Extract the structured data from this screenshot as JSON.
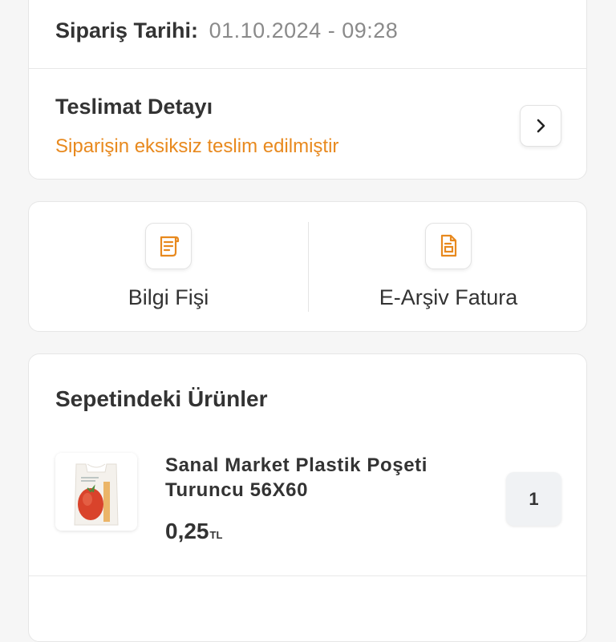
{
  "order": {
    "date_label": "Sipariş Tarihi:",
    "date_value": "01.10.2024 - 09:28"
  },
  "delivery": {
    "title": "Teslimat Detayı",
    "status": "Siparişin eksiksiz teslim edilmiştir",
    "status_color": "#e8891e",
    "action_icon": "chevron-right-icon"
  },
  "documents": [
    {
      "label": "Bilgi Fişi",
      "icon": "receipt-icon"
    },
    {
      "label": "E-Arşiv Fatura",
      "icon": "invoice-icon"
    }
  ],
  "basket": {
    "title": "Sepetindeki Ürünler",
    "items": [
      {
        "name": "Sanal Market Plastik Poşeti Turuncu 56X60",
        "price": "0,25",
        "currency": "TL",
        "quantity": "1"
      }
    ]
  },
  "accent_color": "#e8891e"
}
